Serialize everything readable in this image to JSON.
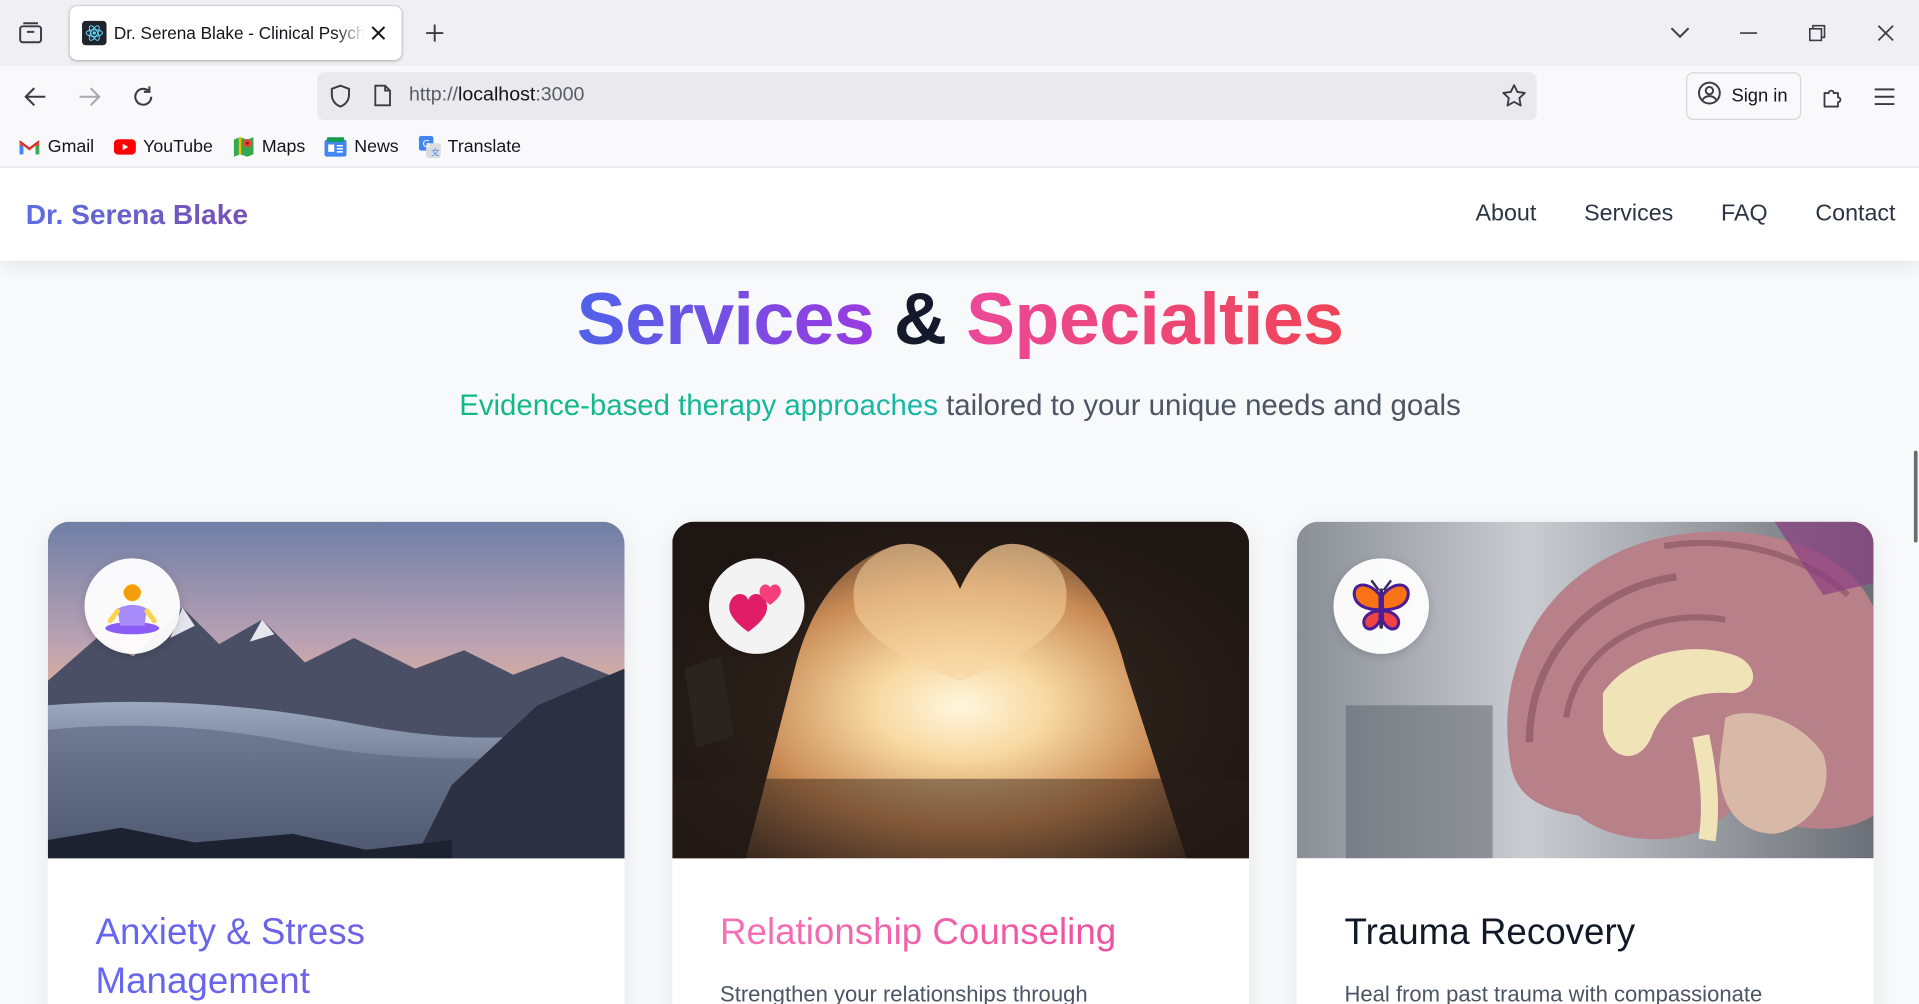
{
  "browser": {
    "tab_title": "Dr. Serena Blake - Clinical Psychologist",
    "url_scheme": "http://",
    "url_host": "localhost",
    "url_port": ":3000",
    "sign_in_label": "Sign in",
    "bookmarks": [
      {
        "label": "Gmail",
        "icon": "gmail-icon"
      },
      {
        "label": "YouTube",
        "icon": "youtube-icon"
      },
      {
        "label": "Maps",
        "icon": "maps-icon"
      },
      {
        "label": "News",
        "icon": "news-icon"
      },
      {
        "label": "Translate",
        "icon": "translate-icon"
      }
    ]
  },
  "site": {
    "brand": "Dr. Serena Blake",
    "nav": [
      "About",
      "Services",
      "FAQ",
      "Contact"
    ]
  },
  "services": {
    "title_part1": "Services",
    "title_amp": "&",
    "title_part2": "Specialties",
    "subtitle_highlight": "Evidence-based therapy approaches",
    "subtitle_rest": " tailored to your unique needs and goals",
    "cards": [
      {
        "title": "Anxiety & Stress Management",
        "text": "",
        "icon": "meditation-icon",
        "title_color": "#6366f1"
      },
      {
        "title": "Relationship Counseling",
        "text": "Strengthen your relationships through",
        "icon": "two-hearts-icon",
        "title_color": "#ec4899"
      },
      {
        "title": "Trauma Recovery",
        "text": "Heal from past trauma with compassionate",
        "icon": "butterfly-icon",
        "title_color": "#111827"
      }
    ]
  }
}
